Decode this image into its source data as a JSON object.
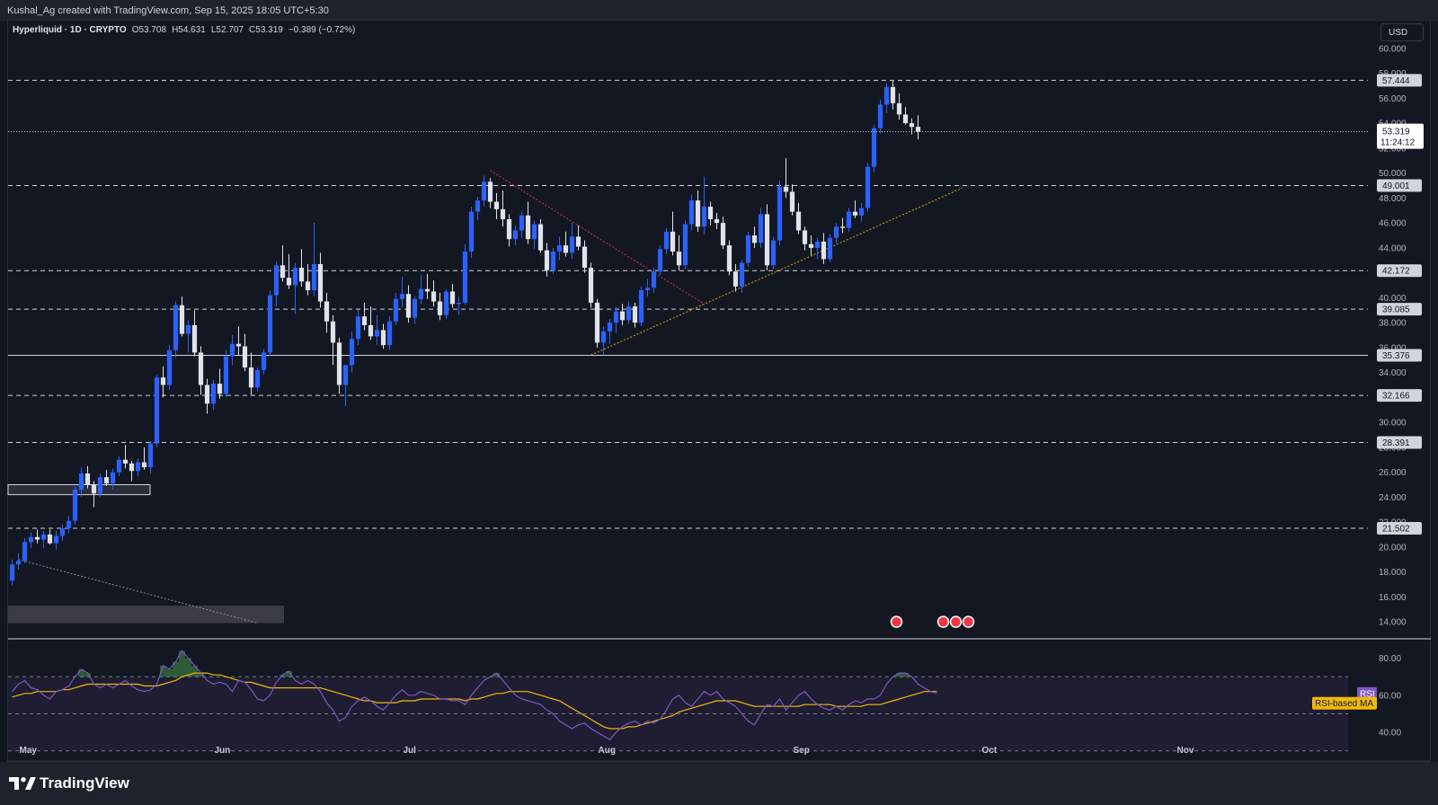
{
  "header": {
    "credit": "Kushal_Ag created with TradingView.com, Sep 15, 2025 18:05 UTC+5:30"
  },
  "legend": {
    "symbol": "Hyperliquid · 1D · CRYPTO",
    "open": "O53.708",
    "high": "H54.631",
    "low": "L52.707",
    "close": "C53.319",
    "change": "−0.389 (−0.72%)"
  },
  "currency": "USD",
  "brand": "TradingView",
  "colors": {
    "background": "#131722",
    "bull": "#2962ff",
    "bear": "#e0e3eb",
    "rsi": "#7e57c2",
    "rsi_ma": "#f0b90b",
    "levels": "#d1d4dc"
  },
  "chart_data": [
    {
      "type": "candlestick",
      "ylim": [
        13,
        61
      ],
      "y_ticks": [
        "60.000",
        "58.000",
        "56.000",
        "54.000",
        "52.000",
        "50.000",
        "48.000",
        "46.000",
        "44.000",
        "42.000",
        "40.000",
        "38.000",
        "36.000",
        "34.000",
        "32.000",
        "30.000",
        "28.000",
        "26.000",
        "24.000",
        "22.000",
        "20.000",
        "18.000",
        "16.000",
        "14.000"
      ],
      "x_ticks": [
        {
          "label": "May",
          "day": 0
        },
        {
          "label": "Jun",
          "day": 31
        },
        {
          "label": "Jul",
          "day": 61
        },
        {
          "label": "Aug",
          "day": 92
        },
        {
          "label": "Sep",
          "day": 123
        },
        {
          "label": "Oct",
          "day": 153
        },
        {
          "label": "Nov",
          "day": 184
        }
      ],
      "last_price": {
        "value": "53.319",
        "countdown": "11:24:12"
      },
      "horizontal_levels": [
        {
          "value": 57.444,
          "label": "57.444",
          "style": "dashed"
        },
        {
          "value": 49.001,
          "label": "49.001",
          "style": "dashed"
        },
        {
          "value": 42.172,
          "label": "42.172",
          "style": "dashed"
        },
        {
          "value": 39.085,
          "label": "39.085",
          "style": "dashed"
        },
        {
          "value": 35.376,
          "label": "35.376",
          "style": "solid"
        },
        {
          "value": 32.166,
          "label": "32.166",
          "style": "dashed"
        },
        {
          "value": 28.391,
          "label": "28.391",
          "style": "dashed"
        },
        {
          "value": 21.502,
          "label": "21.502",
          "style": "dashed"
        }
      ],
      "trendlines": [
        {
          "from": {
            "day": 92,
            "price": 35.4
          },
          "to": {
            "day": 151,
            "price": 48.8
          },
          "color": "#f0b90b"
        },
        {
          "from": {
            "day": 76,
            "price": 50.2
          },
          "to": {
            "day": 110,
            "price": 39.5
          },
          "color": "#f23645"
        },
        {
          "from": {
            "day": 1,
            "price": 19.0
          },
          "to": {
            "day": 39,
            "price": 13.9
          },
          "color": "#9598a1"
        }
      ],
      "ohlc": [
        [
          17.3,
          19.0,
          16.9,
          18.6
        ],
        [
          18.6,
          19.5,
          18.2,
          18.9
        ],
        [
          18.9,
          20.7,
          18.7,
          20.4
        ],
        [
          20.4,
          21.2,
          19.9,
          20.8
        ],
        [
          20.8,
          21.4,
          20.3,
          20.6
        ],
        [
          20.6,
          21.3,
          19.9,
          21.0
        ],
        [
          21.0,
          21.4,
          20.2,
          20.3
        ],
        [
          20.3,
          21.3,
          19.8,
          20.9
        ],
        [
          20.9,
          21.8,
          20.5,
          21.5
        ],
        [
          21.5,
          22.5,
          21.1,
          22.1
        ],
        [
          22.1,
          24.9,
          21.8,
          24.6
        ],
        [
          24.6,
          26.4,
          24.0,
          25.9
        ],
        [
          25.9,
          26.5,
          24.7,
          25.0
        ],
        [
          25.0,
          25.3,
          23.2,
          24.3
        ],
        [
          24.3,
          25.9,
          24.0,
          25.6
        ],
        [
          25.6,
          26.2,
          24.9,
          25.1
        ],
        [
          25.1,
          26.3,
          24.6,
          26.0
        ],
        [
          26.0,
          27.3,
          25.7,
          27.0
        ],
        [
          27.0,
          28.2,
          26.3,
          26.7
        ],
        [
          26.7,
          26.9,
          25.3,
          26.1
        ],
        [
          26.1,
          27.1,
          25.7,
          26.8
        ],
        [
          26.8,
          28.0,
          26.2,
          26.4
        ],
        [
          26.4,
          28.5,
          25.9,
          28.3
        ],
        [
          28.3,
          33.8,
          28.0,
          33.6
        ],
        [
          33.6,
          34.5,
          32.0,
          33.0
        ],
        [
          33.0,
          36.2,
          32.6,
          35.8
        ],
        [
          35.8,
          39.7,
          35.2,
          39.4
        ],
        [
          39.4,
          40.1,
          36.9,
          37.1
        ],
        [
          37.1,
          38.2,
          35.6,
          37.8
        ],
        [
          37.8,
          39.0,
          35.3,
          35.6
        ],
        [
          35.6,
          36.1,
          32.2,
          33.0
        ],
        [
          33.0,
          33.5,
          30.7,
          31.5
        ],
        [
          31.5,
          33.4,
          31.0,
          33.1
        ],
        [
          33.1,
          34.3,
          31.9,
          32.3
        ],
        [
          32.3,
          35.8,
          32.0,
          35.3
        ],
        [
          35.3,
          37.0,
          34.6,
          36.3
        ],
        [
          36.3,
          37.7,
          35.4,
          36.1
        ],
        [
          36.1,
          37.1,
          34.1,
          34.4
        ],
        [
          34.4,
          35.6,
          32.2,
          32.8
        ],
        [
          32.8,
          34.4,
          32.5,
          34.2
        ],
        [
          34.2,
          35.9,
          33.8,
          35.6
        ],
        [
          35.6,
          40.6,
          35.3,
          40.2
        ],
        [
          40.2,
          42.9,
          39.3,
          42.6
        ],
        [
          42.6,
          44.2,
          41.3,
          41.6
        ],
        [
          41.6,
          43.5,
          40.7,
          41.0
        ],
        [
          41.0,
          42.8,
          38.7,
          42.4
        ],
        [
          42.4,
          43.9,
          40.9,
          41.3
        ],
        [
          41.3,
          42.7,
          40.2,
          40.6
        ],
        [
          40.6,
          46.0,
          40.1,
          42.7
        ],
        [
          42.7,
          43.6,
          39.2,
          39.7
        ],
        [
          39.7,
          40.4,
          37.2,
          38.1
        ],
        [
          38.1,
          38.6,
          34.6,
          36.4
        ],
        [
          36.4,
          36.8,
          32.3,
          33.0
        ],
        [
          33.0,
          33.9,
          31.3,
          34.6
        ],
        [
          34.6,
          37.3,
          34.0,
          36.7
        ],
        [
          36.7,
          39.0,
          36.2,
          38.5
        ],
        [
          38.5,
          39.6,
          37.4,
          37.8
        ],
        [
          37.8,
          39.3,
          36.6,
          36.9
        ],
        [
          36.9,
          38.6,
          36.2,
          37.4
        ],
        [
          37.4,
          37.9,
          35.9,
          36.2
        ],
        [
          36.2,
          38.5,
          35.8,
          38.1
        ],
        [
          38.1,
          40.4,
          37.8,
          39.9
        ],
        [
          39.9,
          41.7,
          39.2,
          40.3
        ],
        [
          40.3,
          41.0,
          38.0,
          38.4
        ],
        [
          38.4,
          40.1,
          37.9,
          39.9
        ],
        [
          39.9,
          41.8,
          39.5,
          40.7
        ],
        [
          40.7,
          41.9,
          39.9,
          40.5
        ],
        [
          40.5,
          41.4,
          39.3,
          39.7
        ],
        [
          39.7,
          40.4,
          38.2,
          38.6
        ],
        [
          38.6,
          40.7,
          38.3,
          40.5
        ],
        [
          40.5,
          41.1,
          39.2,
          39.5
        ],
        [
          39.5,
          40.1,
          38.6,
          39.6
        ],
        [
          39.6,
          44.3,
          39.4,
          43.7
        ],
        [
          43.7,
          47.3,
          43.2,
          46.9
        ],
        [
          46.9,
          48.1,
          46.2,
          47.8
        ],
        [
          47.8,
          49.8,
          47.3,
          49.3
        ],
        [
          49.3,
          49.6,
          47.2,
          47.7
        ],
        [
          47.7,
          48.4,
          46.3,
          47.1
        ],
        [
          47.1,
          48.6,
          45.7,
          46.3
        ],
        [
          46.3,
          46.7,
          44.1,
          44.7
        ],
        [
          44.7,
          45.8,
          44.2,
          45.4
        ],
        [
          45.4,
          46.9,
          44.8,
          46.6
        ],
        [
          46.6,
          47.7,
          44.3,
          44.7
        ],
        [
          44.7,
          46.2,
          43.9,
          45.9
        ],
        [
          45.9,
          46.3,
          43.6,
          43.8
        ],
        [
          43.8,
          44.4,
          41.7,
          42.2
        ],
        [
          42.2,
          44.0,
          41.9,
          43.7
        ],
        [
          43.7,
          44.9,
          43.0,
          44.2
        ],
        [
          44.2,
          45.3,
          43.3,
          43.6
        ],
        [
          43.6,
          46.0,
          43.1,
          44.9
        ],
        [
          44.9,
          45.8,
          43.8,
          44.1
        ],
        [
          44.1,
          44.6,
          42.0,
          42.4
        ],
        [
          42.4,
          42.8,
          39.2,
          39.6
        ],
        [
          39.6,
          39.9,
          36.0,
          36.4
        ],
        [
          36.4,
          37.7,
          35.4,
          37.3
        ],
        [
          37.3,
          38.3,
          36.3,
          38.0
        ],
        [
          38.0,
          39.3,
          37.2,
          38.9
        ],
        [
          38.9,
          39.5,
          37.8,
          38.2
        ],
        [
          38.2,
          39.7,
          37.9,
          39.3
        ],
        [
          39.3,
          39.6,
          37.6,
          38.0
        ],
        [
          38.0,
          40.9,
          37.7,
          40.6
        ],
        [
          40.6,
          41.5,
          40.1,
          40.8
        ],
        [
          40.8,
          42.4,
          40.4,
          42.1
        ],
        [
          42.1,
          44.2,
          41.8,
          43.9
        ],
        [
          43.9,
          45.6,
          43.5,
          45.3
        ],
        [
          45.3,
          46.9,
          43.4,
          43.7
        ],
        [
          43.7,
          45.0,
          42.2,
          42.6
        ],
        [
          42.6,
          46.2,
          42.3,
          45.9
        ],
        [
          45.9,
          48.3,
          45.4,
          47.8
        ],
        [
          47.8,
          48.6,
          45.3,
          45.7
        ],
        [
          45.7,
          49.7,
          45.1,
          47.3
        ],
        [
          47.3,
          47.7,
          45.8,
          46.3
        ],
        [
          46.3,
          46.8,
          45.5,
          46.0
        ],
        [
          46.0,
          46.5,
          43.9,
          44.2
        ],
        [
          44.2,
          44.6,
          41.8,
          42.1
        ],
        [
          42.1,
          42.7,
          40.5,
          40.9
        ],
        [
          40.9,
          43.0,
          40.4,
          42.8
        ],
        [
          42.8,
          45.3,
          42.5,
          45.0
        ],
        [
          45.0,
          45.7,
          44.0,
          44.4
        ],
        [
          44.4,
          47.2,
          44.0,
          46.7
        ],
        [
          46.7,
          47.5,
          42.2,
          42.6
        ],
        [
          42.6,
          44.9,
          42.3,
          44.6
        ],
        [
          44.6,
          49.4,
          44.2,
          48.9
        ],
        [
          48.9,
          51.2,
          48.0,
          48.5
        ],
        [
          48.5,
          49.1,
          46.6,
          46.9
        ],
        [
          46.9,
          47.6,
          45.1,
          45.4
        ],
        [
          45.4,
          45.7,
          43.8,
          44.3
        ],
        [
          44.3,
          45.0,
          43.4,
          44.0
        ],
        [
          44.0,
          44.8,
          43.1,
          44.5
        ],
        [
          44.5,
          45.2,
          42.7,
          43.1
        ],
        [
          43.1,
          45.1,
          42.8,
          44.8
        ],
        [
          44.8,
          46.0,
          44.4,
          45.7
        ],
        [
          45.7,
          46.4,
          45.2,
          45.6
        ],
        [
          45.6,
          47.2,
          45.3,
          46.9
        ],
        [
          46.9,
          47.8,
          46.4,
          46.6
        ],
        [
          46.6,
          47.6,
          46.1,
          47.2
        ],
        [
          47.2,
          50.8,
          46.9,
          50.5
        ],
        [
          50.5,
          53.9,
          50.1,
          53.6
        ],
        [
          53.6,
          55.9,
          53.2,
          55.5
        ],
        [
          55.5,
          57.2,
          54.8,
          56.9
        ],
        [
          56.9,
          57.4,
          55.1,
          55.6
        ],
        [
          55.6,
          56.4,
          54.3,
          54.7
        ],
        [
          54.7,
          55.3,
          53.9,
          54.0
        ],
        [
          54.0,
          54.4,
          53.1,
          53.7
        ],
        [
          53.708,
          54.631,
          52.707,
          53.319
        ]
      ]
    },
    {
      "type": "line",
      "series": [
        {
          "name": "RSI",
          "color": "#7e57c2"
        },
        {
          "name": "RSI-based MA",
          "color": "#f0b90b"
        }
      ],
      "ylim": [
        25,
        90
      ],
      "y_ticks": [
        "80.00",
        "60.00",
        "40.00"
      ],
      "bands": [
        70,
        50,
        30
      ],
      "rsi": [
        62,
        66,
        68,
        64,
        63,
        60,
        58,
        62,
        63,
        65,
        70,
        74,
        72,
        66,
        64,
        66,
        64,
        66,
        68,
        65,
        63,
        62,
        63,
        66,
        76,
        74,
        78,
        84,
        80,
        76,
        72,
        68,
        66,
        67,
        66,
        62,
        68,
        67,
        63,
        58,
        57,
        60,
        67,
        71,
        73,
        68,
        66,
        68,
        66,
        62,
        56,
        52,
        46,
        48,
        54,
        57,
        59,
        57,
        54,
        52,
        56,
        60,
        63,
        60,
        60,
        62,
        61,
        60,
        58,
        58,
        57,
        57,
        55,
        60,
        64,
        68,
        70,
        72,
        68,
        64,
        60,
        58,
        57,
        56,
        55,
        52,
        50,
        46,
        44,
        42,
        44,
        45,
        42,
        40,
        38,
        36,
        40,
        43,
        45,
        46,
        44,
        46,
        45,
        47,
        52,
        58,
        60,
        56,
        54,
        58,
        62,
        60,
        62,
        58,
        56,
        54,
        50,
        46,
        44,
        50,
        55,
        54,
        58,
        52,
        56,
        60,
        62,
        58,
        55,
        53,
        52,
        54,
        52,
        55,
        57,
        56,
        58,
        58,
        60,
        66,
        70,
        72,
        72,
        70,
        66,
        64,
        62,
        61
      ],
      "rsi_ma": [
        59,
        60,
        61,
        61,
        62,
        62,
        62,
        62,
        63,
        63,
        64,
        65,
        66,
        66,
        66,
        66,
        66,
        66,
        66,
        66,
        66,
        65,
        65,
        65,
        66,
        67,
        68,
        70,
        71,
        72,
        72,
        72,
        71,
        71,
        70,
        69,
        68,
        67,
        67,
        66,
        65,
        64,
        64,
        64,
        64,
        64,
        64,
        64,
        64,
        64,
        63,
        62,
        61,
        60,
        59,
        58,
        57,
        57,
        56,
        56,
        56,
        56,
        57,
        57,
        57,
        58,
        58,
        58,
        58,
        58,
        58,
        58,
        57,
        58,
        58,
        59,
        60,
        61,
        61,
        62,
        62,
        62,
        62,
        61,
        60,
        59,
        58,
        57,
        55,
        53,
        51,
        49,
        47,
        45,
        43,
        42,
        42,
        42,
        43,
        43,
        44,
        45,
        46,
        47,
        48,
        49,
        51,
        52,
        53,
        54,
        55,
        56,
        57,
        57,
        57,
        57,
        56,
        55,
        54,
        54,
        54,
        54,
        54,
        54,
        54,
        54,
        55,
        55,
        55,
        55,
        55,
        54,
        54,
        54,
        54,
        54,
        55,
        55,
        55,
        56,
        57,
        58,
        59,
        60,
        61,
        62,
        62,
        62
      ]
    }
  ]
}
